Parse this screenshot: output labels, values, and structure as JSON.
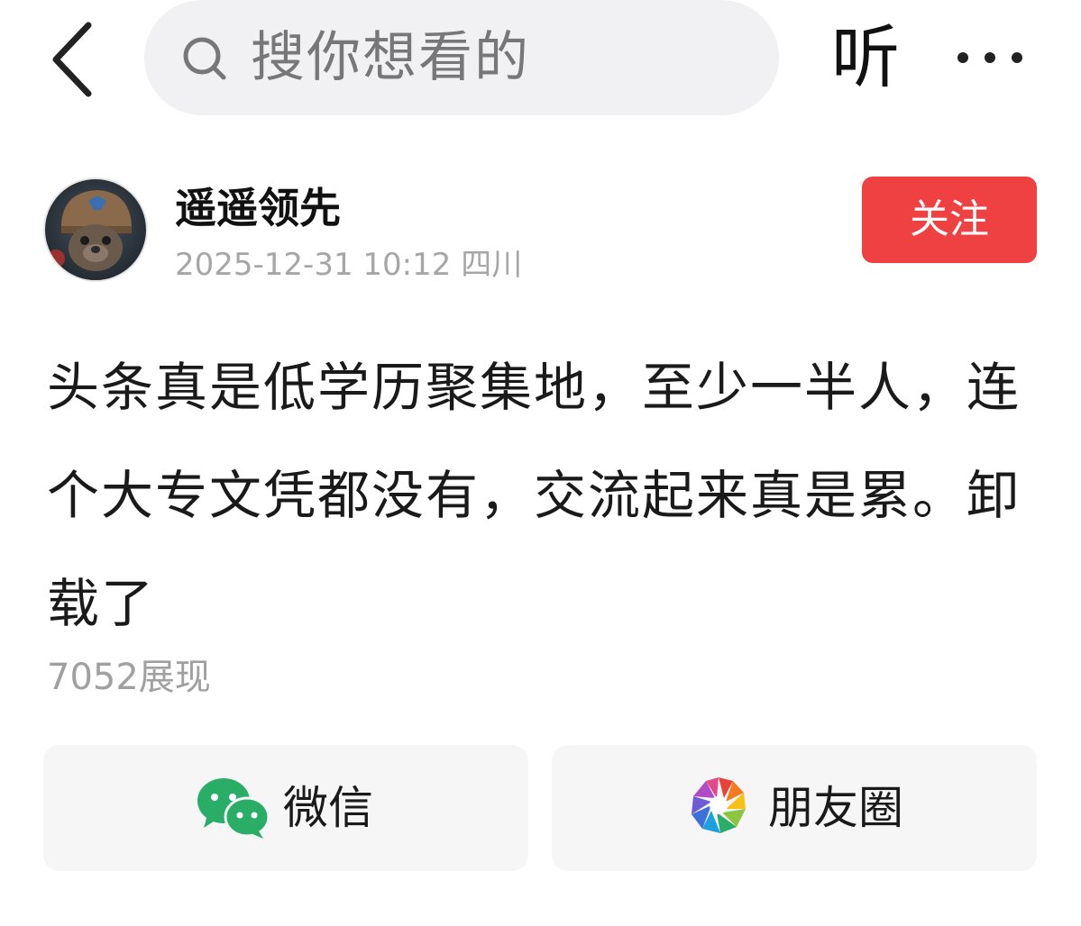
{
  "header": {
    "search_placeholder": "搜你想看的",
    "listen_label": "听"
  },
  "author": {
    "name": "遥遥领先",
    "meta": "2025-12-31 10:12 四川",
    "follow_label": "关注"
  },
  "post": {
    "text": "头条真是低学历聚集地，至少一半人，连个大专文凭都没有，交流起来真是累。卸载了",
    "views": "7052展现"
  },
  "share": {
    "wechat_label": "微信",
    "moments_label": "朋友圈"
  },
  "colors": {
    "accent": "#f04142",
    "wechat_green": "#2aae67",
    "search_bg": "#f1f1f3",
    "muted_text": "#a6a6a6"
  }
}
